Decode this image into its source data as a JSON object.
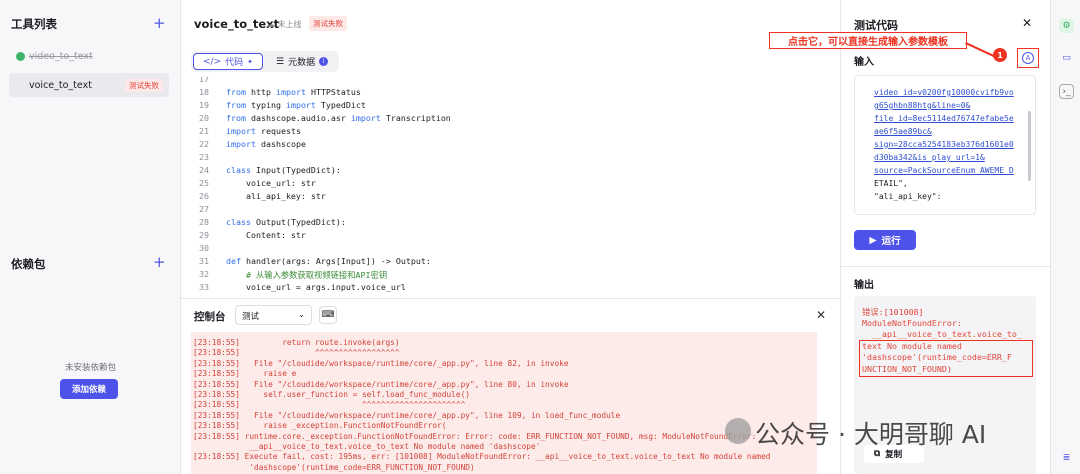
{
  "sidebar": {
    "tools_title": "工具列表",
    "tools": [
      {
        "label": "video_to_text",
        "status": ""
      },
      {
        "label": "voice_to_text",
        "status": "测试失败"
      }
    ],
    "deps_title": "依赖包",
    "deps_empty": "未安装依赖包",
    "add_deps": "添加依赖"
  },
  "header": {
    "title": "voice_to_text",
    "publish_status": "未上线",
    "test_status": "测试失败",
    "tabs": [
      {
        "label": "代码"
      },
      {
        "label": "元数据"
      }
    ]
  },
  "code": {
    "lines": [
      {
        "n": "17",
        "t": ""
      },
      {
        "n": "18",
        "t": "from http import HTTPStatus"
      },
      {
        "n": "19",
        "t": "from typing import TypedDict"
      },
      {
        "n": "20",
        "t": "from dashscope.audio.asr import Transcription"
      },
      {
        "n": "21",
        "t": "import requests"
      },
      {
        "n": "22",
        "t": "import dashscope"
      },
      {
        "n": "23",
        "t": ""
      },
      {
        "n": "24",
        "t": "class Input(TypedDict):"
      },
      {
        "n": "25",
        "t": "    voice_url: str"
      },
      {
        "n": "26",
        "t": "    ali_api_key: str"
      },
      {
        "n": "27",
        "t": ""
      },
      {
        "n": "28",
        "t": "class Output(TypedDict):"
      },
      {
        "n": "29",
        "t": "    Content: str"
      },
      {
        "n": "30",
        "t": ""
      },
      {
        "n": "31",
        "t": "def handler(args: Args[Input]) -> Output:"
      },
      {
        "n": "32",
        "t": "    # 从输入参数获取视频链接和API密钥"
      },
      {
        "n": "33",
        "t": "    voice_url = args.input.voice_url"
      }
    ]
  },
  "console": {
    "title": "控制台",
    "env": "测试",
    "lines": [
      "[23:18:55]         return route.invoke(args)",
      "[23:18:55]                ^^^^^^^^^^^^^^^^^^",
      "[23:18:55]   File \"/cloudide/workspace/runtime/core/_app.py\", line 82, in invoke",
      "[23:18:55]     raise e",
      "[23:18:55]   File \"/cloudide/workspace/runtime/core/_app.py\", line 80, in invoke",
      "[23:18:55]     self.user_function = self.load_func_module()",
      "[23:18:55]                          ^^^^^^^^^^^^^^^^^^^^^^",
      "[23:18:55]   File \"/cloudide/workspace/runtime/core/_app.py\", line 109, in load_func_module",
      "[23:18:55]     raise _exception.FunctionNotFoundError(",
      "[23:18:55] runtime.core._exception.FunctionNotFoundError: Error: code: ERR_FUNCTION_NOT_FOUND, msg: ModuleNotFoundError:",
      "            __api__voice_to_text.voice_to_text No module named 'dashscope'",
      "[23:18:55] Execute fail, cost: 195ms, err: [101008] ModuleNotFoundError: __api__voice_to_text.voice_to_text No module named",
      "            'dashscope'(runtime_code=ERR_FUNCTION_NOT_FOUND)"
    ]
  },
  "test_panel": {
    "title": "测试代码",
    "input_label": "输入",
    "input_lines": [
      "video_id=v0200fg10000cvifb9vo",
      "g65ghbn88htg&line=0&",
      "file_id=8ec5114ed76747efabe5e",
      "ae6f5ae89bc&",
      "sign=28cca5254183eb376d1601e0",
      "d30ba342&is_play_url=1&",
      "source=PackSourceEnum_AWEME_D",
      "ETAIL\",",
      "\"ali_api_key\":"
    ],
    "run_label": "运行",
    "output_label": "输出",
    "output_lines": [
      "错误:[101008]",
      "ModuleNotFoundError:",
      "  __api__voice_to_text.voice_to_",
      "text No module named",
      "'dashscope'(runtime_code=ERR_F",
      "UNCTION_NOT_FOUND)"
    ],
    "copy_label": "复制"
  },
  "annotation": {
    "text": "点击它，可以直接生成输入参数模板",
    "badge": "1"
  },
  "watermark": "公众号 · 大明哥聊 AI",
  "colors": {
    "accent": "#4d53e8",
    "error": "#e0453a",
    "annotation": "#ee3322"
  }
}
